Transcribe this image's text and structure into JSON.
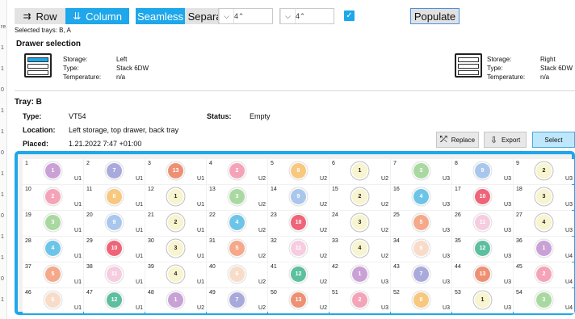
{
  "toolbar": {
    "row_label": "Row",
    "column_label": "Column",
    "seamless_label": "Seamless",
    "separate_label": "Separate",
    "rows_value": "4",
    "columns_value": "4",
    "populate_label": "Populate"
  },
  "selected_trays": "Selected trays:  B, A",
  "drawer_selection": {
    "title": "Drawer selection",
    "left": {
      "storage_label": "Storage:",
      "storage_value": "Left",
      "type_label": "Type:",
      "type_value": "Stack 6DW",
      "temp_label": "Temperature:",
      "temp_value": "n/a"
    },
    "right": {
      "storage_label": "Storage:",
      "storage_value": "Right",
      "type_label": "Type:",
      "type_value": "Stack 6DW",
      "temp_label": "Temperature:",
      "temp_value": "n/a"
    }
  },
  "tray": {
    "title": "Tray: B",
    "type_label": "Type:",
    "type_value": "VT54",
    "status_label": "Status:",
    "status_value": "Empty",
    "location_label": "Location:",
    "location_value": "Left storage, top drawer, back tray",
    "placed_label": "Placed:",
    "placed_value": "1.21.2022 7:47  +01:00"
  },
  "actions": {
    "replace": "Replace",
    "export": "Export",
    "select": "Select"
  },
  "colors": {
    "1": "#c9a1d6",
    "2": "#f5a3b8",
    "3": "#a9d9a0",
    "4": "#6cc5e8",
    "5": "#f5a98a",
    "6": "#f8dcc9",
    "7": "#aaa9dc",
    "8": "#f7c87e",
    "9": "#a9c7ec",
    "10": "#ef6478",
    "11": "#f6cde0",
    "12": "#5cbf9f",
    "13": "#ee9073"
  },
  "edge_labels": [
    "re",
    "1",
    "1",
    "0",
    "1",
    "1",
    "0",
    "1",
    "1",
    "0",
    "1",
    "1",
    "0",
    "1"
  ],
  "cells": [
    {
      "n": "1",
      "c": "1",
      "u": "U1"
    },
    {
      "n": "2",
      "c": "7",
      "u": "U1"
    },
    {
      "n": "3",
      "c": "13",
      "u": "U1"
    },
    {
      "n": "4",
      "c": "2",
      "u": "U2"
    },
    {
      "n": "5",
      "c": "8",
      "u": "U2"
    },
    {
      "n": "6",
      "c": "1",
      "u": "U2"
    },
    {
      "n": "7",
      "c": "3",
      "u": "U3"
    },
    {
      "n": "8",
      "c": "9",
      "u": "U3"
    },
    {
      "n": "9",
      "c": "2",
      "u": "U3"
    },
    {
      "n": "10",
      "c": "2",
      "u": "U1"
    },
    {
      "n": "11",
      "c": "8",
      "u": "U1"
    },
    {
      "n": "12",
      "c": "1",
      "u": "U1"
    },
    {
      "n": "13",
      "c": "3",
      "u": "U2"
    },
    {
      "n": "14",
      "c": "9",
      "u": "U2"
    },
    {
      "n": "15",
      "c": "2",
      "u": "U2"
    },
    {
      "n": "16",
      "c": "4",
      "u": "U3"
    },
    {
      "n": "17",
      "c": "10",
      "u": "U3"
    },
    {
      "n": "18",
      "c": "3",
      "u": "U3"
    },
    {
      "n": "19",
      "c": "3",
      "u": "U1"
    },
    {
      "n": "20",
      "c": "9",
      "u": "U1"
    },
    {
      "n": "21",
      "c": "2",
      "u": "U1"
    },
    {
      "n": "22",
      "c": "4",
      "u": "U2"
    },
    {
      "n": "23",
      "c": "10",
      "u": "U2"
    },
    {
      "n": "24",
      "c": "3",
      "u": "U2"
    },
    {
      "n": "25",
      "c": "5",
      "u": "U3"
    },
    {
      "n": "26",
      "c": "11",
      "u": "U3"
    },
    {
      "n": "27",
      "c": "4",
      "u": "U3"
    },
    {
      "n": "28",
      "c": "4",
      "u": "U1"
    },
    {
      "n": "29",
      "c": "10",
      "u": "U1"
    },
    {
      "n": "30",
      "c": "3",
      "u": "U1"
    },
    {
      "n": "31",
      "c": "5",
      "u": "U2"
    },
    {
      "n": "32",
      "c": "11",
      "u": "U2"
    },
    {
      "n": "33",
      "c": "4",
      "u": "U2"
    },
    {
      "n": "34",
      "c": "6",
      "u": "U3"
    },
    {
      "n": "35",
      "c": "12",
      "u": "U3"
    },
    {
      "n": "36",
      "c": "1",
      "u": "U4"
    },
    {
      "n": "37",
      "c": "5",
      "u": "U1"
    },
    {
      "n": "38",
      "c": "11",
      "u": "U1"
    },
    {
      "n": "39",
      "c": "4",
      "u": "U1"
    },
    {
      "n": "40",
      "c": "6",
      "u": "U2"
    },
    {
      "n": "41",
      "c": "12",
      "u": "U2"
    },
    {
      "n": "42",
      "c": "1",
      "u": "U3"
    },
    {
      "n": "43",
      "c": "7",
      "u": "U3"
    },
    {
      "n": "44",
      "c": "13",
      "u": "U3"
    },
    {
      "n": "45",
      "c": "2",
      "u": "U4"
    },
    {
      "n": "46",
      "c": "6",
      "u": "U1"
    },
    {
      "n": "47",
      "c": "12",
      "u": "U1"
    },
    {
      "n": "48",
      "c": "1",
      "u": "U2"
    },
    {
      "n": "49",
      "c": "7",
      "u": "U2"
    },
    {
      "n": "50",
      "c": "13",
      "u": "U2"
    },
    {
      "n": "51",
      "c": "2",
      "u": "U3"
    },
    {
      "n": "52",
      "c": "8",
      "u": "U3"
    },
    {
      "n": "53",
      "c": "1",
      "u": "U3"
    },
    {
      "n": "54",
      "c": "3",
      "u": "U4"
    }
  ]
}
